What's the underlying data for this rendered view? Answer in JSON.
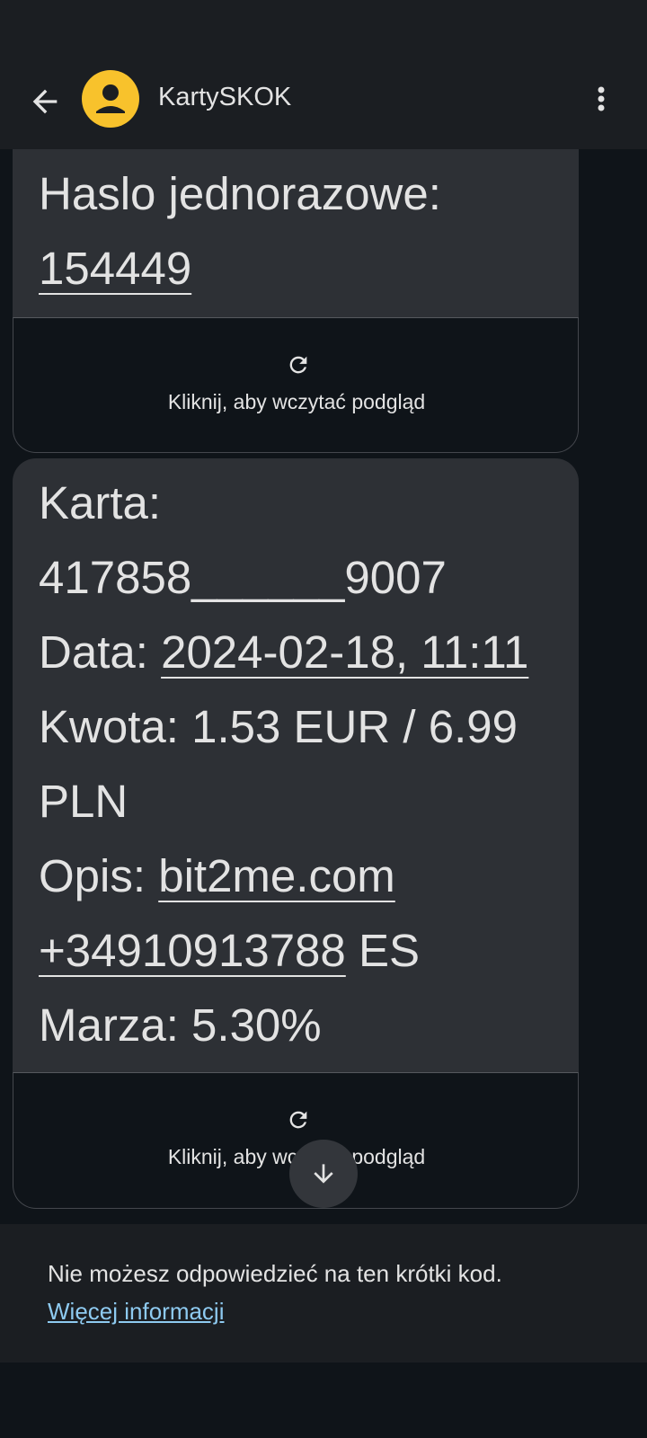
{
  "header": {
    "title": "KartySKOK"
  },
  "messages": [
    {
      "lines": [
        {
          "text": "Haslo jednorazowe:"
        },
        {
          "link": "154449"
        }
      ],
      "preview_label": "Kliknij, aby wczytać podgląd"
    },
    {
      "lines": {
        "karta": "Karta:",
        "card_number": "417858______9007",
        "data_prefix": "Data: ",
        "data_value": "2024-02-18, 11:11",
        "kwota_line1": "Kwota: 1.53 EUR / 6.99",
        "kwota_line2": "PLN",
        "opis_prefix": "Opis: ",
        "opis_link": "bit2me.com",
        "phone_link": "+34910913788",
        "phone_suffix": " ES",
        "marza": "Marza: 5.30%"
      },
      "preview_label": "Kliknij, aby wczytać podgląd"
    }
  ],
  "footer": {
    "text": "Nie możesz odpowiedzieć na ten krótki kod.",
    "link": "Więcej informacji"
  },
  "colors": {
    "background": "#0f1419",
    "bubble": "#2d3035",
    "avatar": "#f8c22c",
    "link": "#8ecaf0"
  }
}
